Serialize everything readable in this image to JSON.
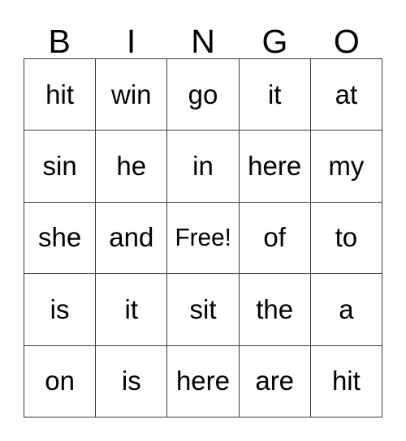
{
  "card": {
    "title": "BINGO",
    "columns": [
      "B",
      "I",
      "N",
      "G",
      "O"
    ],
    "free_space_label": "Free!",
    "free_space_position": {
      "row": 2,
      "col": 2
    },
    "grid_rows": 5,
    "grid_cols": 5,
    "colors": {
      "background": "#ffffff",
      "text": "#000000",
      "border": "#3a3a3a"
    },
    "rows": [
      {
        "cells": [
          "hit",
          "win",
          "go",
          "it",
          "at"
        ]
      },
      {
        "cells": [
          "sin",
          "he",
          "in",
          "here",
          "my"
        ]
      },
      {
        "cells": [
          "she",
          "and",
          "Free!",
          "of",
          "to"
        ]
      },
      {
        "cells": [
          "is",
          "it",
          "sit",
          "the",
          "a"
        ]
      },
      {
        "cells": [
          "on",
          "is",
          "here",
          "are",
          "hit"
        ]
      }
    ]
  }
}
